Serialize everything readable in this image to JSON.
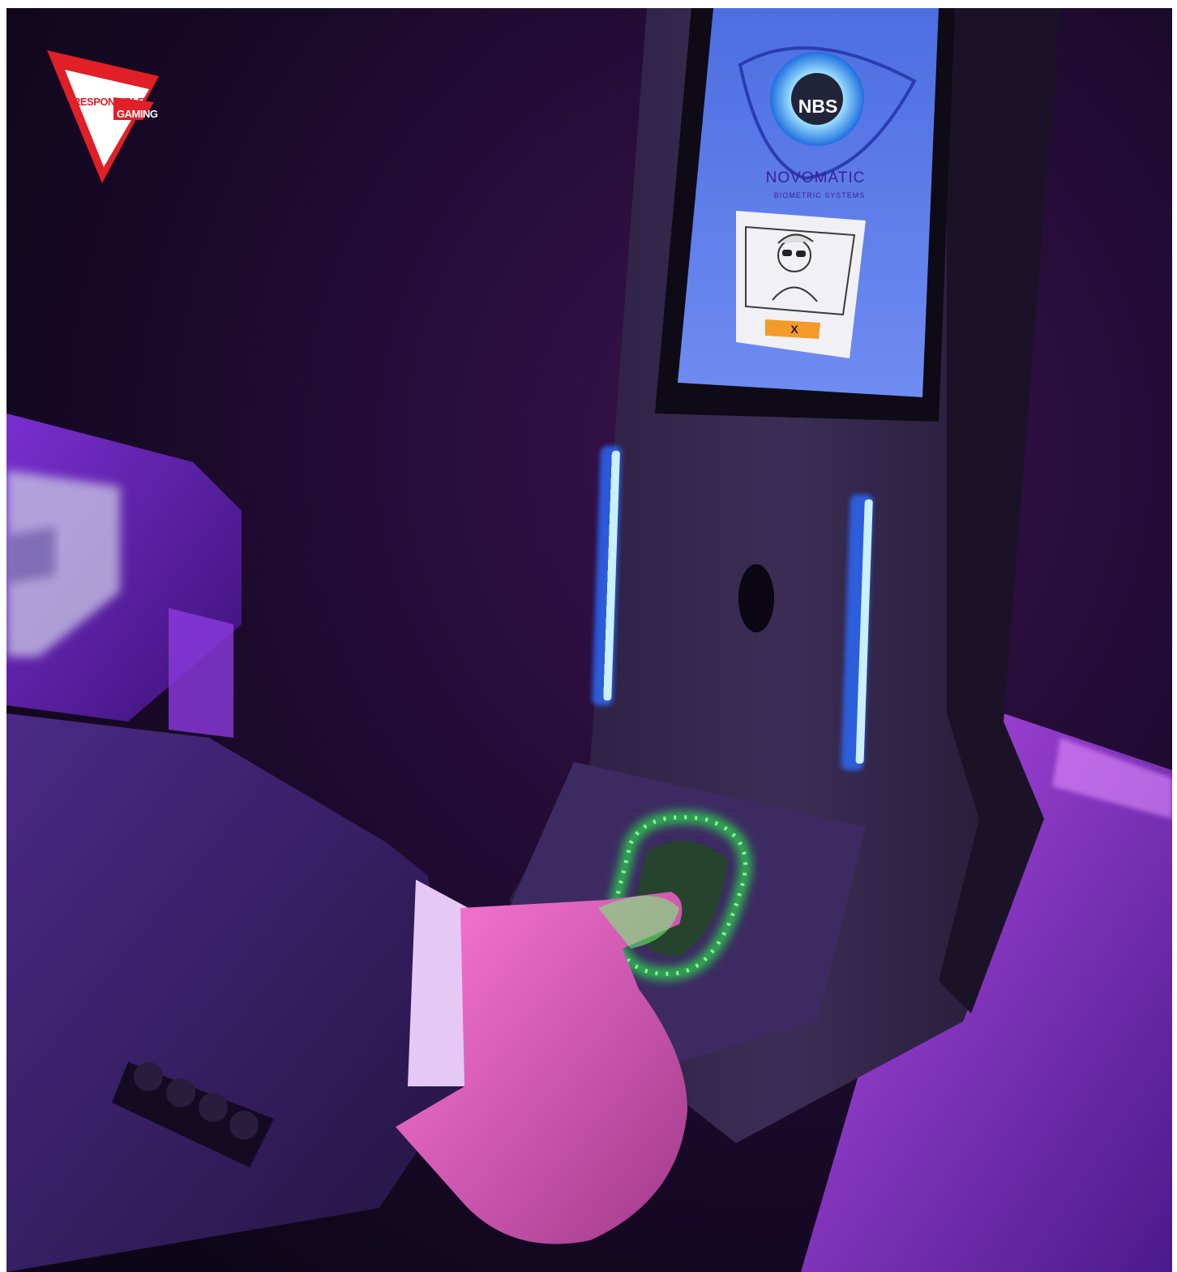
{
  "badge": {
    "line1": "RESPONSIBLE",
    "line2": "GAMING",
    "colors": {
      "red": "#e01f26",
      "white": "#ffffff"
    }
  },
  "kiosk_screen": {
    "logo_text": "NBS",
    "brand_text": "NOVOMATIC",
    "brand_subtext": "BIOMETRIC SYSTEMS",
    "cancel_label": "X",
    "colors": {
      "screen": "#5a78e8",
      "button": "#f39a2b",
      "ring": "#2a8df0"
    }
  },
  "scene": {
    "description_colors": {
      "background": "#1a0a2a",
      "purple_light": "#8a2be2",
      "fingerprint_glow": "#39ff5a",
      "led_strip": "#6fd3ff",
      "hand": "#e06ac6"
    }
  }
}
